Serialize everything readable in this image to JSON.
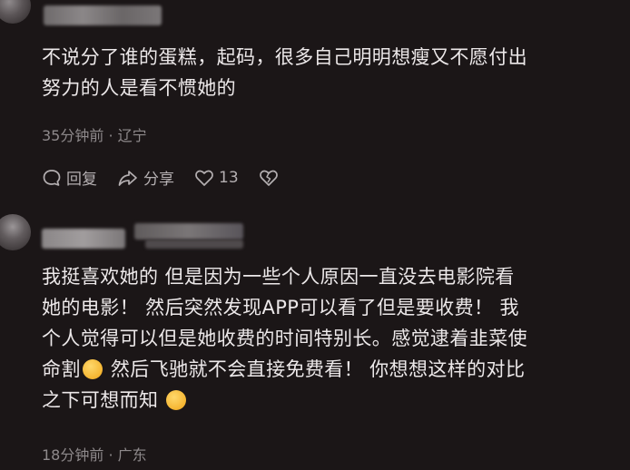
{
  "comments": [
    {
      "text_line1": "不说分了谁的蛋糕，起码，很多自己明明想瘦又不愿付出",
      "text_line2": "努力的人是看不惯她的",
      "time": "35分钟前",
      "separator": "·",
      "location": "辽宁",
      "actions": {
        "reply_label": "回复",
        "share_label": "分享",
        "like_count": "13"
      }
    },
    {
      "text_line1": "我挺喜欢她的 但是因为一些个人原因一直没去电影院看",
      "text_line2": "她的电影！ 然后突然发现APP可以看了但是要收费！ 我",
      "text_line3": "个人觉得可以但是她收费的时间特别长。感觉逮着韭菜使",
      "text_line4a": "命割",
      "text_line4b": " 然后飞驰就不会直接免费看！ 你想想这样的对比",
      "text_line5": "之下可想而知",
      "time": "18分钟前",
      "separator": "·",
      "location": "广东"
    }
  ]
}
